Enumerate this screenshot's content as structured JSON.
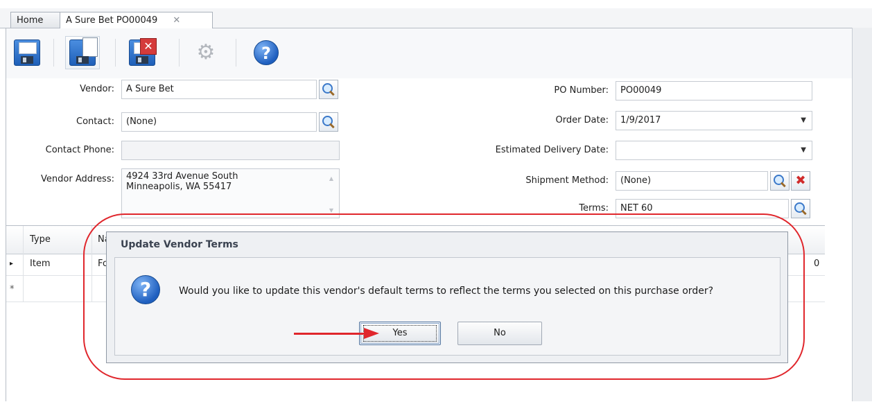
{
  "tabs": [
    {
      "label": "Home",
      "active": false
    },
    {
      "label": "A Sure Bet PO00049",
      "active": true,
      "close_glyph": "✕"
    }
  ],
  "toolbar": {
    "buttons": [
      {
        "name": "save-icon"
      },
      {
        "name": "save-new-icon"
      },
      {
        "name": "save-close-icon"
      },
      {
        "name": "gear-icon",
        "disabled": true
      },
      {
        "name": "help-icon"
      }
    ]
  },
  "form_left": {
    "vendor": {
      "label": "Vendor:",
      "value": "A Sure Bet"
    },
    "contact": {
      "label": "Contact:",
      "value": "(None)"
    },
    "contact_phone": {
      "label": "Contact Phone:",
      "value": ""
    },
    "vendor_address": {
      "label": "Vendor Address:",
      "line1": "4924 33rd Avenue South",
      "line2": "Minneapolis, WA 55417"
    }
  },
  "form_right": {
    "po_number": {
      "label": "PO Number:",
      "value": "PO00049"
    },
    "order_date": {
      "label": "Order Date:",
      "value": "1/9/2017"
    },
    "estimated_delivery": {
      "label": "Estimated Delivery Date:",
      "value": ""
    },
    "shipment_method": {
      "label": "Shipment Method:",
      "value": "(None)"
    },
    "terms": {
      "label": "Terms:",
      "value": "NET 60"
    }
  },
  "grid": {
    "columns": [
      "Type",
      "Na"
    ],
    "rows": [
      {
        "marker": "▸",
        "type": "Item",
        "name": "Fo",
        "trailing": "0"
      },
      {
        "marker": "*",
        "type": "",
        "name": "",
        "trailing": ""
      }
    ]
  },
  "dialog": {
    "title": "Update Vendor Terms",
    "message": "Would you like to update this vendor's default terms to reflect the terms you selected on this purchase order?",
    "yes_label": "Yes",
    "no_label": "No"
  },
  "colors": {
    "annotation": "#e0262c",
    "accent": "#1f5fbf"
  }
}
